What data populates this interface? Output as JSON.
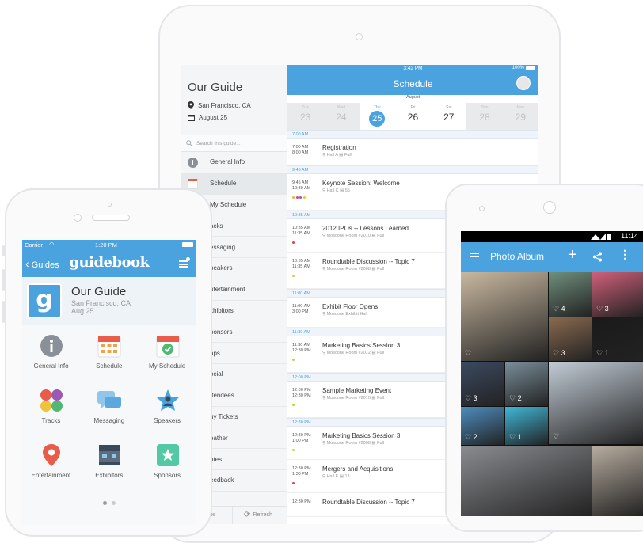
{
  "tablet": {
    "sidebar": {
      "title": "Our Guide",
      "location": "San Francisco, CA",
      "date": "August 25",
      "search_placeholder": "Search this guide...",
      "items": [
        {
          "label": "General Info",
          "icon": "info-icon"
        },
        {
          "label": "Schedule",
          "icon": "calendar-icon"
        },
        {
          "label": "My Schedule"
        },
        {
          "label": "acks"
        },
        {
          "label": "essaging"
        },
        {
          "label": "peakers"
        },
        {
          "label": "ntertainment"
        },
        {
          "label": "xhibitors"
        },
        {
          "label": "ponsors"
        },
        {
          "label": "aps"
        },
        {
          "label": "ocial"
        },
        {
          "label": "ttendees"
        },
        {
          "label": "uy Tickets"
        },
        {
          "label": "eather"
        },
        {
          "label": "otes"
        },
        {
          "label": "eedback"
        }
      ],
      "bottom_left": "es",
      "refresh_label": "Refresh"
    },
    "header": {
      "status_time": "3:42 PM",
      "battery": "100%",
      "title": "Schedule"
    },
    "calendar": {
      "month": "August",
      "days": [
        {
          "dow": "Tue",
          "num": "23",
          "state": "dim"
        },
        {
          "dow": "Wed",
          "num": "24",
          "state": "dim"
        },
        {
          "dow": "Thu",
          "num": "25",
          "state": "sel"
        },
        {
          "dow": "Fri",
          "num": "26",
          "state": "normal"
        },
        {
          "dow": "Sat",
          "num": "27",
          "state": "normal"
        },
        {
          "dow": "Sun",
          "num": "28",
          "state": "dim"
        },
        {
          "dow": "Mon",
          "num": "29",
          "state": "dim"
        }
      ]
    },
    "schedule": [
      {
        "section": "7:00 AM"
      },
      {
        "start": "7:00 AM",
        "end": "8:00 AM",
        "name": "Registration",
        "location": "Hall A",
        "capacity": "Full",
        "height": 34
      },
      {
        "section": "9:45 AM"
      },
      {
        "start": "9:45 AM",
        "end": "10:30 AM",
        "name": "Keynote Session: Welcome",
        "location": "Hall C",
        "capacity": "55",
        "height": 46,
        "dots": [
          "#e7b73c",
          "#d9457a",
          "#9b59b6",
          "#f0c33c"
        ]
      },
      {
        "section": "10:35 AM"
      },
      {
        "start": "10:35 AM",
        "end": "11:35 AM",
        "name": "2012 IPOs -- Lessons Learned",
        "location": "Moscone Room #2010",
        "capacity": "Full",
        "height": 42,
        "dots": [
          "#d94545"
        ]
      },
      {
        "start": "10:35 AM",
        "end": "11:35 AM",
        "name": "Roundtable Discussion -- Topic 7",
        "location": "Moscone Room #2008",
        "capacity": "Full",
        "height": 46,
        "dots": [
          "#e7c53c"
        ]
      },
      {
        "section": "11:00 AM"
      },
      {
        "start": "11:00 AM",
        "end": "3:00 PM",
        "name": "Exhibit Floor Opens",
        "location": "Moscone Exhibit Hall",
        "height": 38
      },
      {
        "section": "11:30 AM"
      },
      {
        "start": "11:30 AM",
        "end": "12:30 PM",
        "name": "Marketing Basics Session 3",
        "location": "Moscone Room #2012",
        "capacity": "Full",
        "height": 46,
        "dots": [
          "#c7d040"
        ]
      },
      {
        "section": "12:00 PM"
      },
      {
        "start": "12:00 PM",
        "end": "12:30 PM",
        "name": "Sample Marketing Event",
        "location": "Moscone Room #2010",
        "capacity": "Full",
        "height": 46,
        "dots": [
          "#c7d040"
        ]
      },
      {
        "section": "12:30 PM"
      },
      {
        "start": "12:30 PM",
        "end": "1:00 PM",
        "name": "Marketing Basics Session 3",
        "location": "Moscone Room #2008",
        "capacity": "Full",
        "height": 42,
        "dots": [
          "#c7d040"
        ]
      },
      {
        "start": "12:30 PM",
        "end": "1:30 PM",
        "name": "Mergers and Acquisitions",
        "location": "Hall E",
        "capacity": "13",
        "height": 42,
        "dots": [
          "#d94545"
        ]
      },
      {
        "start": "12:30 PM",
        "end": "",
        "name": "Roundtable Discussion -- Topic 7",
        "location": "",
        "height": 30
      }
    ]
  },
  "iphone": {
    "status": {
      "carrier": "Carrier",
      "time": "1:20 PM"
    },
    "nav": {
      "back_label": "Guides",
      "logo": "guidebook"
    },
    "guide": {
      "initial": "g",
      "name": "Our Guide",
      "location": "San Francisco, CA",
      "date": "Aug 25"
    },
    "grid": [
      {
        "label": "General Info",
        "icon": "info-icon"
      },
      {
        "label": "Schedule",
        "icon": "calendar-icon"
      },
      {
        "label": "My Schedule",
        "icon": "calendar-check-icon"
      },
      {
        "label": "Tracks",
        "icon": "tracks-icon"
      },
      {
        "label": "Messaging",
        "icon": "chat-bubbles-icon"
      },
      {
        "label": "Speakers",
        "icon": "star-person-icon"
      },
      {
        "label": "Entertainment",
        "icon": "map-pin-icon"
      },
      {
        "label": "Exhibitors",
        "icon": "booth-icon"
      },
      {
        "label": "Sponsors",
        "icon": "sponsor-star-icon"
      }
    ]
  },
  "android": {
    "status": {
      "time": "11:14"
    },
    "toolbar": {
      "title": "Photo Album",
      "add_label": "+",
      "share_label": "<",
      "more_label": "⋮"
    },
    "photos": [
      {
        "likes": "",
        "color": "#c9b8a0"
      },
      {
        "likes": "4",
        "color": "#6f8f7c"
      },
      {
        "likes": "3",
        "color": "#d0607a"
      },
      {
        "likes": "3",
        "color": "#8a6a50"
      },
      {
        "likes": "1",
        "color": "#1a1a1a"
      },
      {
        "likes": "3",
        "color": "#3b4a60"
      },
      {
        "likes": "2",
        "color": "#7a8e9a"
      },
      {
        "likes": "",
        "color": "#c2ccd6"
      },
      {
        "likes": "2",
        "color": "#4d8ec0"
      },
      {
        "likes": "1",
        "color": "#3fb8d8"
      },
      {
        "likes": "",
        "color": "#8a8c90"
      },
      {
        "likes": "",
        "color": "#b8ada0"
      }
    ]
  }
}
